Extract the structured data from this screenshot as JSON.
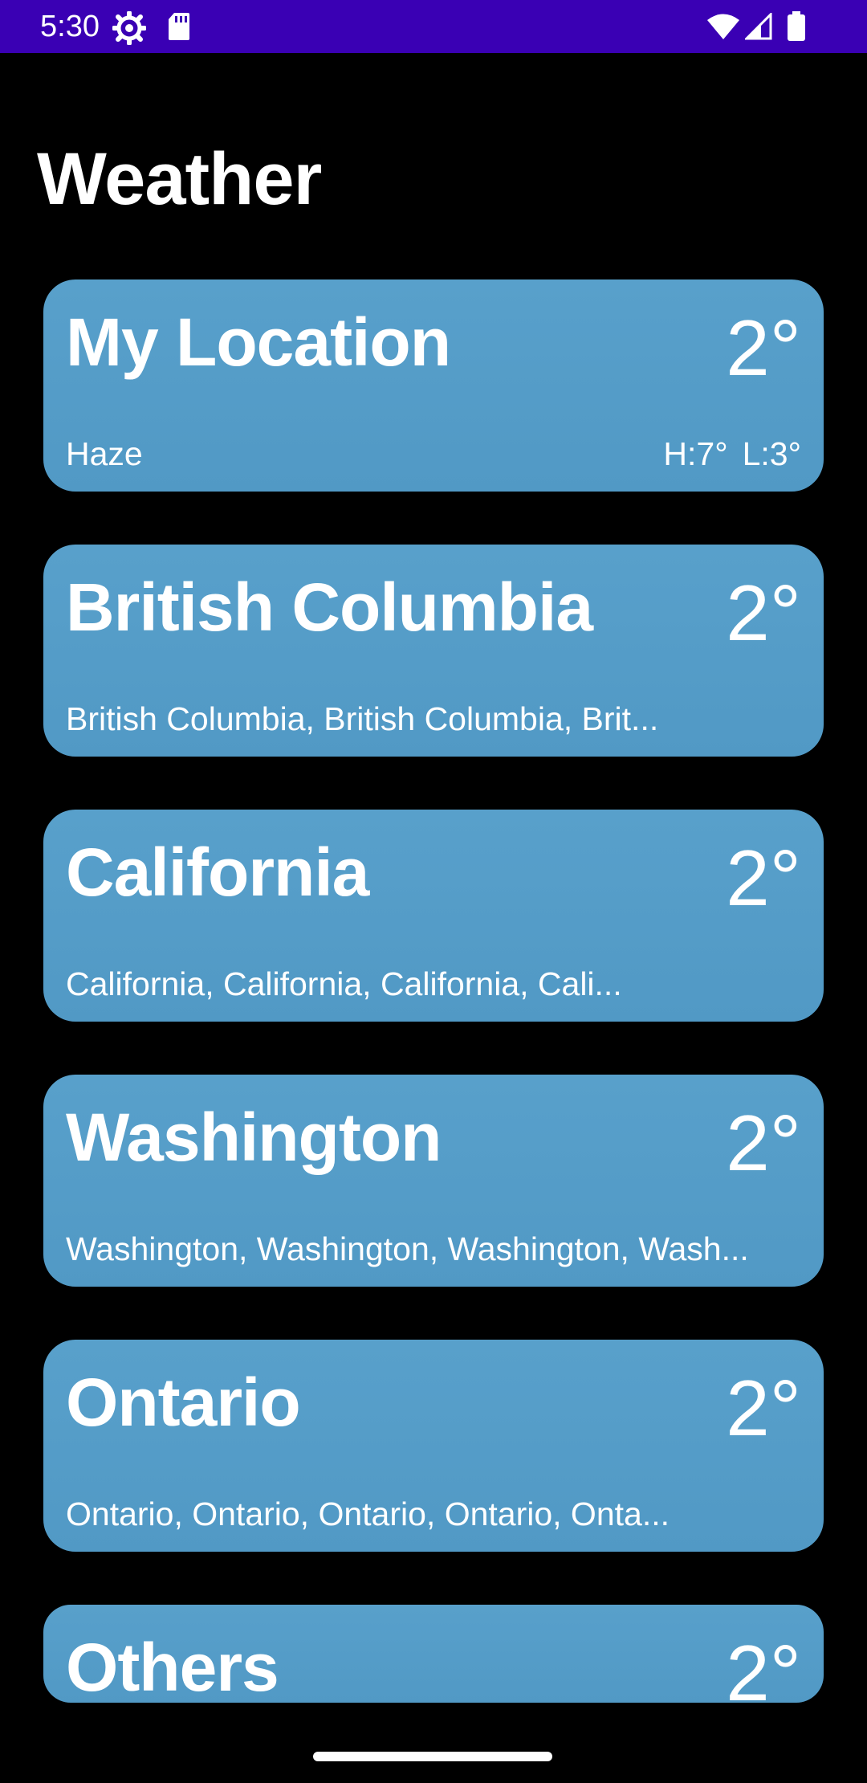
{
  "status_bar": {
    "time": "5:30",
    "icons": [
      "settings-gear-icon",
      "sd-card-icon",
      "wifi-icon",
      "cell-signal-icon",
      "battery-icon"
    ],
    "background_color": "#3a00b4"
  },
  "header": {
    "title": "Weather"
  },
  "cards": [
    {
      "name": "My Location",
      "temp": "2°",
      "condition": "Haze",
      "high": "H:7°",
      "low": "L:3°"
    },
    {
      "name": "British Columbia",
      "temp": "2°",
      "subtitle": "British Columbia, British Columbia, Brit..."
    },
    {
      "name": "California",
      "temp": "2°",
      "subtitle": "California, California, California, Cali..."
    },
    {
      "name": "Washington",
      "temp": "2°",
      "subtitle": "Washington, Washington, Washington, Wash..."
    },
    {
      "name": "Ontario",
      "temp": "2°",
      "subtitle": "Ontario, Ontario, Ontario, Ontario, Onta..."
    },
    {
      "name": "Others",
      "temp": "2°"
    }
  ],
  "colors": {
    "background": "#000000",
    "card": "#5599c7",
    "text": "#ffffff"
  }
}
